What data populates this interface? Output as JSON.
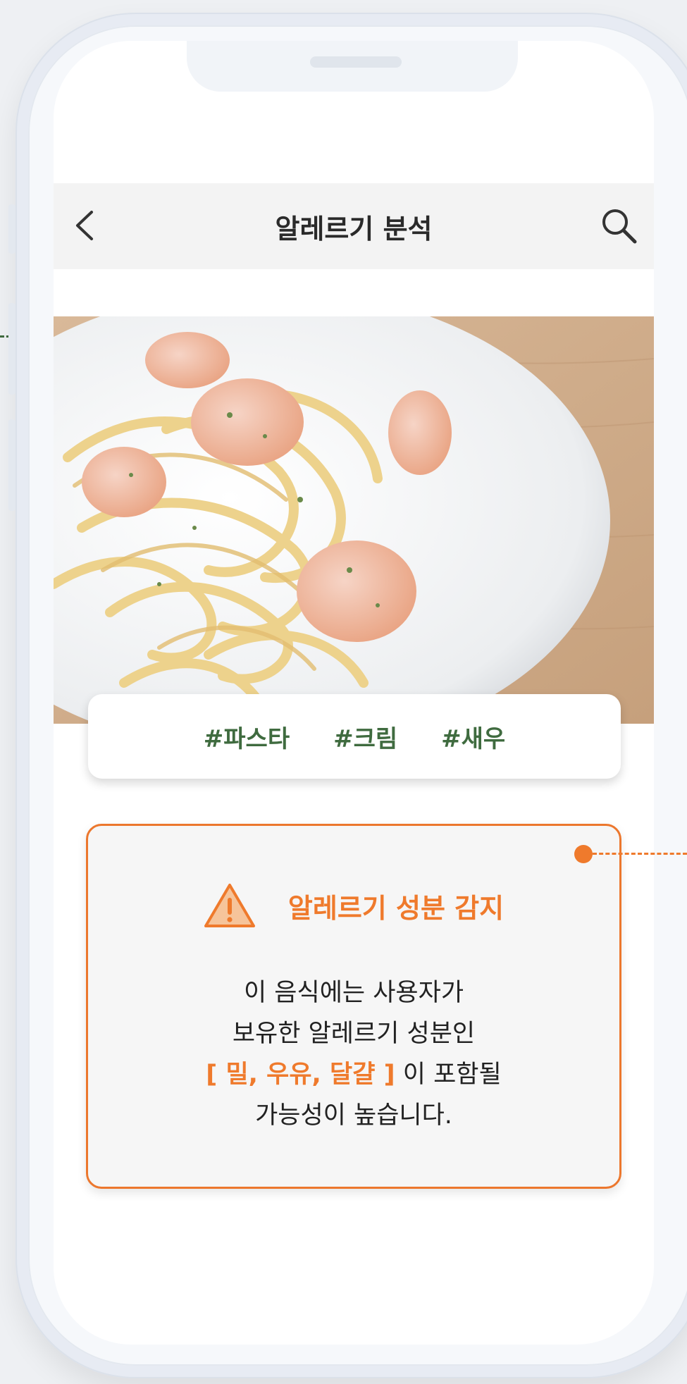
{
  "header": {
    "title": "알레르기 분석"
  },
  "icons": {
    "back": "chevron-left-icon",
    "search": "search-icon",
    "warning": "warning-triangle-icon"
  },
  "tags": [
    "#파스타",
    "#크림",
    "#새우"
  ],
  "alert": {
    "title": "알레르기 성분 감지",
    "line1": "이 음식에는 사용자가",
    "line2": "보유한 알레르기 성분인",
    "allergens": "[ 밀, 우유, 달걀 ]",
    "line3_suffix": " 이 포함될",
    "line4": "가능성이 높습니다."
  },
  "colors": {
    "accent_orange": "#ef7a2c",
    "tag_green": "#3f6b3f",
    "header_bg": "#f3f3f3"
  }
}
